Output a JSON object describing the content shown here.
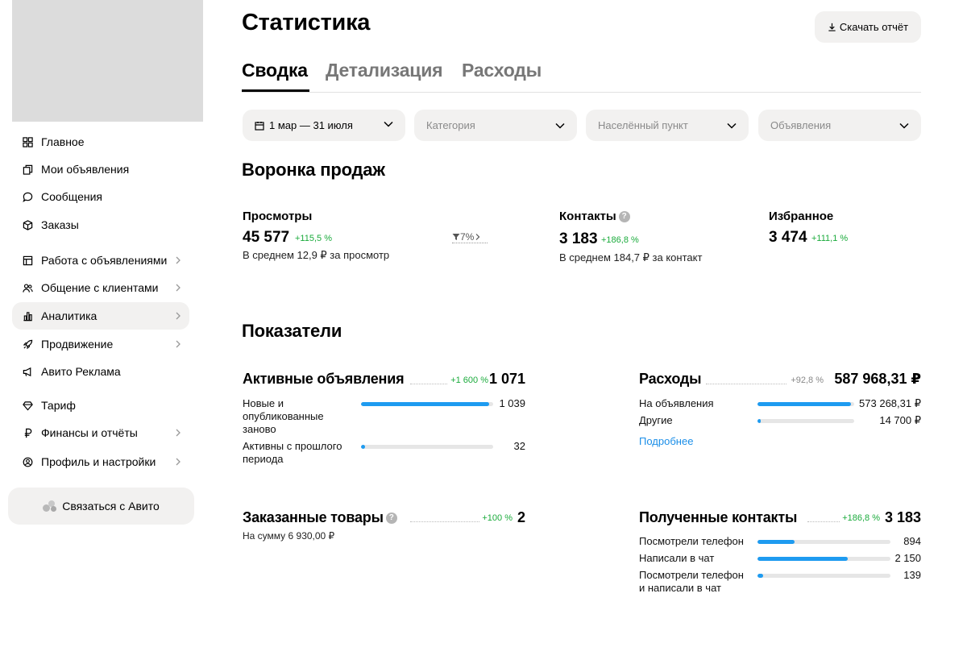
{
  "sidebar": {
    "items": [
      {
        "label": "Главное",
        "icon": "grid-icon"
      },
      {
        "label": "Мои объявления",
        "icon": "copy-icon"
      },
      {
        "label": "Сообщения",
        "icon": "chat-icon"
      },
      {
        "label": "Заказы",
        "icon": "box-icon"
      },
      {
        "label": "Работа с объявлениями",
        "icon": "ads-icon"
      },
      {
        "label": "Общение с клиентами",
        "icon": "users-icon"
      },
      {
        "label": "Аналитика",
        "icon": "chart-icon"
      },
      {
        "label": "Продвижение",
        "icon": "rocket-icon"
      },
      {
        "label": "Авито Реклама",
        "icon": "megaphone-icon"
      },
      {
        "label": "Тариф",
        "icon": "diamond-icon"
      },
      {
        "label": "Финансы и отчёты",
        "icon": "ruble-icon"
      },
      {
        "label": "Профиль и настройки",
        "icon": "profile-icon"
      }
    ],
    "contact_label": "Связаться с Авито"
  },
  "header": {
    "title": "Статистика",
    "download_label": "Скачать отчёт"
  },
  "tabs": [
    {
      "label": "Сводка",
      "active": true
    },
    {
      "label": "Детализация",
      "active": false
    },
    {
      "label": "Расходы",
      "active": false
    }
  ],
  "filters": {
    "period": "1 мар — 31 июля",
    "category": "Категория",
    "locality": "Населённый пункт",
    "listings": "Объявления"
  },
  "funnel": {
    "title": "Воронка продаж",
    "views": {
      "label": "Просмотры",
      "value": "45 577",
      "growth": "+115,5 %",
      "sub": "В среднем 12,9 ₽ за просмотр"
    },
    "conversion": "7%",
    "contacts": {
      "label": "Контакты",
      "value": "3 183",
      "growth": "+186,8 %",
      "sub": "В среднем 184,7 ₽ за контакт",
      "help": "?"
    },
    "favorites": {
      "label": "Избранное",
      "value": "3 474",
      "growth": "+111,1 %"
    }
  },
  "indicators": {
    "title": "Показатели",
    "active_ads": {
      "title": "Активные объявления",
      "growth": "+1 600 %",
      "value": "1 071",
      "rows": [
        {
          "label": "Новые и опубликованные заново",
          "value": "1 039",
          "fraction": 0.97
        },
        {
          "label": "Активны с прошлого периода",
          "value": "32",
          "fraction": 0.03
        }
      ]
    },
    "expenses": {
      "title": "Расходы",
      "growth": "+92,8 %",
      "value": "587 968,31 ₽",
      "rows": [
        {
          "label": "На объявления",
          "value": "573 268,31 ₽",
          "fraction": 0.97
        },
        {
          "label": "Другие",
          "value": "14 700 ₽",
          "fraction": 0.03
        }
      ],
      "link": "Подробнее"
    },
    "ordered": {
      "title": "Заказанные товары",
      "growth": "+100 %",
      "value": "2",
      "sub": "На сумму 6 930,00 ₽",
      "help": "?"
    },
    "contacts": {
      "title": "Полученные контакты",
      "growth": "+186,8 %",
      "value": "3 183",
      "rows": [
        {
          "label": "Посмотрели телефон",
          "value": "894",
          "fraction": 0.28
        },
        {
          "label": "Написали в чат",
          "value": "2 150",
          "fraction": 0.68
        },
        {
          "label": "Посмотрели телефон и написали в чат",
          "value": "139",
          "fraction": 0.04
        }
      ]
    }
  },
  "colors": {
    "accent_blue": "#1e9bf0",
    "growth_green": "#1bab3c",
    "chip_bg": "#f2f1f0"
  }
}
